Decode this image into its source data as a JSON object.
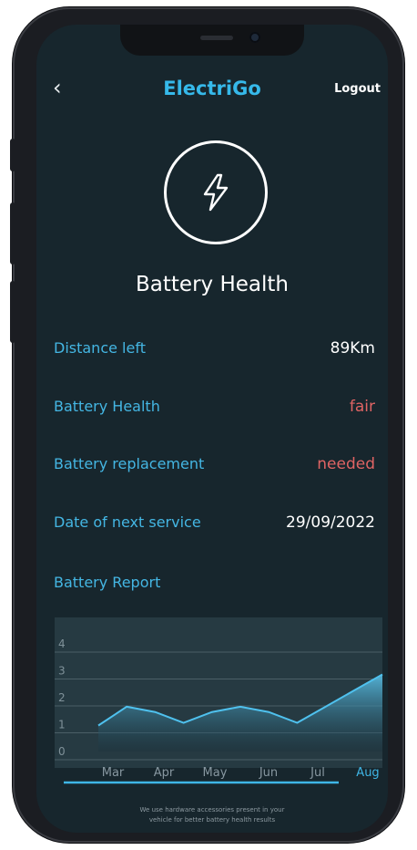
{
  "header": {
    "back_icon": "chevron-left-icon",
    "title": "ElectriGo",
    "logout_label": "Logout"
  },
  "hero": {
    "icon": "lightning-bolt-icon",
    "title": "Battery Health"
  },
  "stats": [
    {
      "label": "Distance left",
      "value": "89Km",
      "color": "#ffffff"
    },
    {
      "label": "Battery Health",
      "value": "fair",
      "color": "#e06464"
    },
    {
      "label": "Battery replacement",
      "value": "needed",
      "color": "#e06464"
    },
    {
      "label": "Date of next service",
      "value": "29/09/2022",
      "color": "#ffffff"
    }
  ],
  "report": {
    "title": "Battery Report"
  },
  "chart_data": {
    "type": "area",
    "categories": [
      "Mar",
      "Apr",
      "May",
      "Jun",
      "Jul",
      "Aug"
    ],
    "x": [
      0,
      1,
      2,
      3,
      4,
      5,
      6,
      7,
      8,
      9,
      10
    ],
    "values": [
      1.0,
      1.7,
      1.5,
      1.1,
      1.5,
      1.7,
      1.5,
      1.1,
      1.7,
      2.3,
      2.9
    ],
    "y_ticks": [
      "4",
      "3",
      "2",
      "1",
      "0"
    ],
    "ylim": [
      0,
      4
    ],
    "grid": true,
    "selected_category": "Aug",
    "colors": {
      "line": "#4fc1ee",
      "fill_top": "#5cc7f0",
      "fill_bottom": "#17303b",
      "bg": "#263a42"
    }
  },
  "footer": {
    "line1": "We use hardware accessories present in your",
    "line2": "vehicle for better battery health results"
  }
}
